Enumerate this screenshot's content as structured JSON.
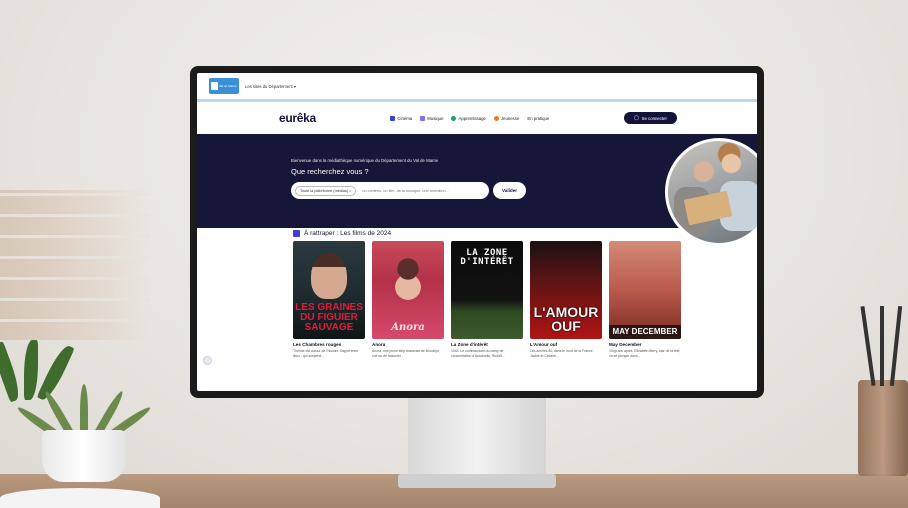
{
  "topbar": {
    "gov_logo_label": "Val de Marne",
    "gov_link": "Les sites du Département ▾"
  },
  "header": {
    "brand": "eurêka",
    "nav": [
      {
        "label": "Cinéma",
        "color": "#3f3dd9"
      },
      {
        "label": "Musique",
        "color": "#8a6df0"
      },
      {
        "label": "Apprentissage",
        "color": "#1aa46a"
      },
      {
        "label": "Jeunesse",
        "color": "#f07a2a"
      },
      {
        "label": "En pratique",
        "color": ""
      }
    ],
    "login_label": "Se connecter"
  },
  "hero": {
    "subtitle": "Bienvenue dans la médiathèque numérique du Département du Val de Marne",
    "title": "Que recherchez vous ?",
    "search_chip": "Toute la plateforme (médias) ×",
    "search_placeholder": "un contenu, un film, de la musique, une formation...",
    "search_button": "Valider"
  },
  "section": {
    "title": "À rattraper : Les films de 2024",
    "cards": [
      {
        "poster_text": "LES GRAINES DU FIGUIER SAUVAGE",
        "title": "Les Chambres rouges",
        "desc": "Théorie est autour de l'histoire Sayyid entre lieux - qui suspend..."
      },
      {
        "poster_text": "Anora",
        "title": "Anora",
        "desc": "Anora, une jeune strip-teaseuse de Brooklyn, voit sa vie basculer..."
      },
      {
        "poster_text": "LA ZONE D'INTÉRÊT",
        "title": "La Zone d'intérêt",
        "desc": "1943. Le commandant du camp de concentration d'Auschwitz, Rudolf..."
      },
      {
        "poster_text": "L'AMOUR OUF",
        "title": "L'Amour ouf",
        "desc": "Les années 80, dans le nord de la France. Jackie et Clotaire..."
      },
      {
        "poster_text": "MAY DECEMBER",
        "title": "May December",
        "desc": "Vingt ans après, Elizabeth Berry, star de la télé, va se plonger dans..."
      }
    ]
  }
}
